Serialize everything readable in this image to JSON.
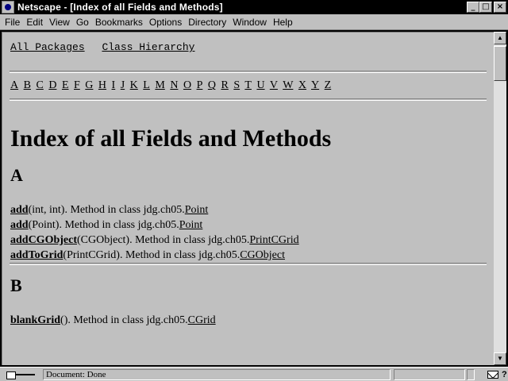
{
  "window": {
    "title": "Netscape - [Index of all Fields and Methods]",
    "minimize": "_",
    "maximize": "□",
    "close": "×"
  },
  "menu": [
    "File",
    "Edit",
    "View",
    "Go",
    "Bookmarks",
    "Options",
    "Directory",
    "Window",
    "Help"
  ],
  "page": {
    "links": [
      "All Packages",
      "Class Hierarchy"
    ],
    "alphabet": [
      "A",
      "B",
      "C",
      "D",
      "E",
      "F",
      "G",
      "H",
      "I",
      "J",
      "K",
      "L",
      "M",
      "N",
      "O",
      "P",
      "Q",
      "R",
      "S",
      "T",
      "U",
      "V",
      "W",
      "X",
      "Y",
      "Z"
    ],
    "heading": "Index of all Fields and Methods",
    "section_a": "A",
    "entries_a": [
      {
        "name": "add",
        "rest": "(int, int). Method in class jdg.ch05.",
        "cls": "Point"
      },
      {
        "name": "add",
        "rest": "(Point). Method in class jdg.ch05.",
        "cls": "Point"
      },
      {
        "name": "addCGObject",
        "rest": "(CGObject). Method in class jdg.ch05.",
        "cls": "PrintCGrid"
      },
      {
        "name": "addToGrid",
        "rest": "(PrintCGrid). Method in class jdg.ch05.",
        "cls": "CGObject"
      }
    ],
    "section_b": "B",
    "entries_b": [
      {
        "name": "blankGrid",
        "rest": "(). Method in class jdg.ch05.",
        "cls": "CGrid"
      }
    ]
  },
  "status": {
    "text": "Document: Done"
  },
  "icons": {
    "app": "netscape-icon",
    "security": "key-icon",
    "mail": "mail-icon",
    "help": "question-icon"
  }
}
